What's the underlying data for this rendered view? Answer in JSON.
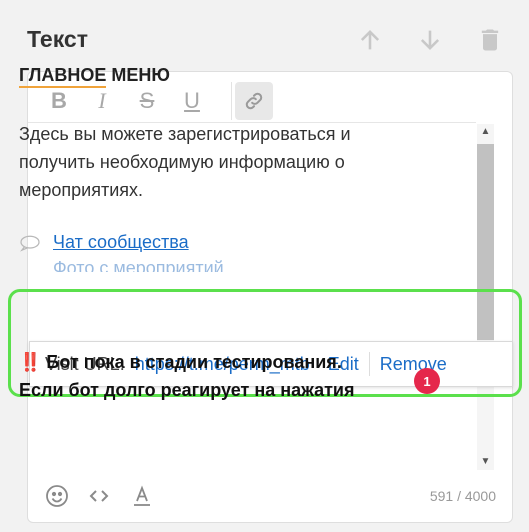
{
  "panel": {
    "title": "Текст"
  },
  "header_icons": [
    "arrow-up-icon",
    "arrow-down-icon",
    "trash-icon"
  ],
  "toolbar": {
    "bold_label": "B",
    "italic_label": "I",
    "strike_label": "S",
    "underline_label": "U",
    "link_icon": "link-icon"
  },
  "content": {
    "heading_underlined": "ГЛАВНОЕ",
    "heading_rest": " МЕНЮ",
    "paragraph": "Здесь вы можете зарегистрироваться и получить необходимую информацию о мероприятиях.",
    "link_text": "Чат сообщества",
    "link_partial": "Фото с мероприятий",
    "note_line1": "‼️ Бот пока в стадии тестирования.",
    "note_line2": "Если бот долго реагирует на нажатия"
  },
  "link_popup": {
    "label": "Visit URL:",
    "url": "https://t.me/perm_mtb",
    "edit": "Edit",
    "remove": "Remove"
  },
  "badge": {
    "count": "1"
  },
  "footer": {
    "counter": "591 / 4000"
  },
  "colors": {
    "link": "#1a6cc7",
    "highlight_border": "#5be04c",
    "badge": "#e5274b",
    "heading_underline": "#f0a33a"
  }
}
